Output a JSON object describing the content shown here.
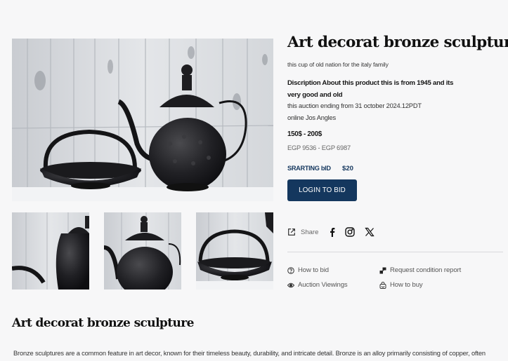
{
  "product": {
    "title": "Art decorat bronze sculpture",
    "subtitle": "this cup of old nation for the italy family",
    "description": "Discription About this product this is from 1945 and its very good and old",
    "auction_ending": "this auction ending from 31 october 2024.12PDT",
    "location": "online Jos Angles",
    "price_range": "150$ - 200$",
    "egp_range": "EGP 9536 - EGP 6987",
    "starting_bid_label": "SRARTING bID",
    "starting_bid_value": "$20",
    "bid_button": "LOGIN TO BID"
  },
  "share": {
    "label": "Share",
    "icons": [
      "share-icon",
      "facebook-icon",
      "instagram-icon",
      "x-icon"
    ]
  },
  "links": {
    "how_to_bid": "How to bid",
    "request_report": "Request condition report",
    "auction_viewings": "Auction Viewings",
    "how_to_buy": "How to buy"
  },
  "section": {
    "title": "Art decorat bronze sculpture",
    "body": "Bronze sculptures are a common feature in art decor, known for their timeless beauty, durability, and intricate detail. Bronze is an alloy primarily consisting of copper, often"
  },
  "colors": {
    "accent": "#14375e",
    "background": "#f7f7f8"
  }
}
